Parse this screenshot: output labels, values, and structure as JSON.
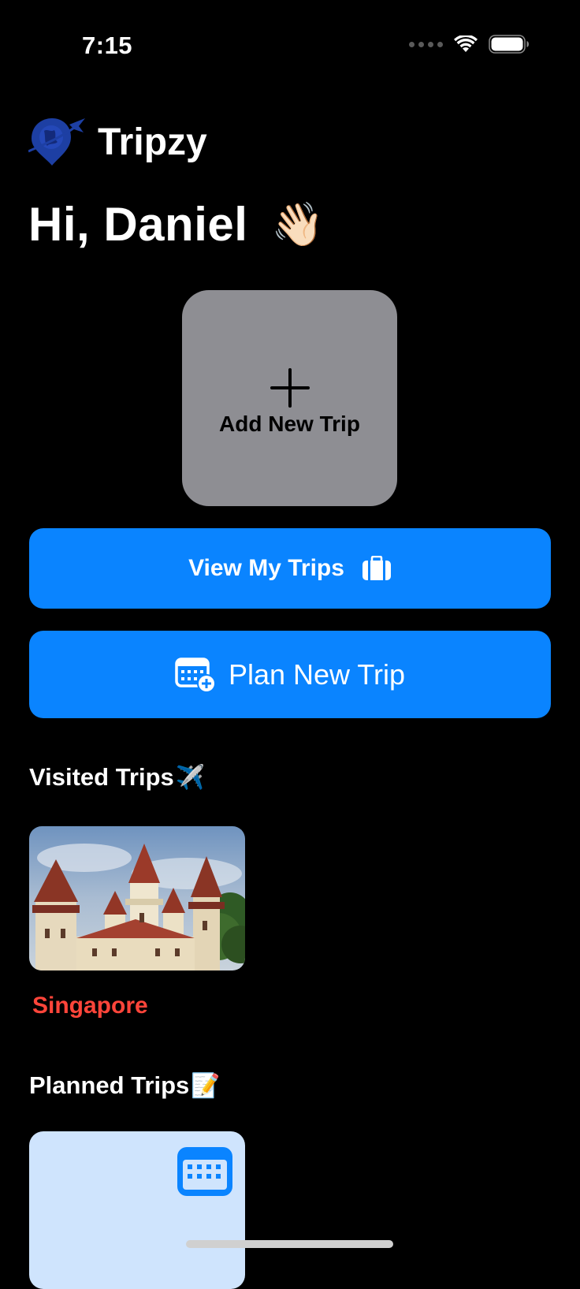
{
  "status_bar": {
    "time": "7:15"
  },
  "app": {
    "name": "Tripzy",
    "logo_icon": "globe-pin-plane-icon"
  },
  "greeting": {
    "text": "Hi, Daniel",
    "emoji": "👋🏻"
  },
  "add_trip": {
    "label": "Add New Trip",
    "icon": "plus-icon"
  },
  "buttons": {
    "view_trips": {
      "label": "View My Trips",
      "icon": "suitcase-icon"
    },
    "plan_trip": {
      "label": "Plan New Trip",
      "icon": "calendar-add-icon"
    }
  },
  "visited": {
    "title": "Visited Trips",
    "emoji": "✈️",
    "trips": [
      {
        "name": "Singapore"
      }
    ]
  },
  "planned": {
    "title": "Planned Trips",
    "emoji": "📝",
    "card_icon": "calendar-icon"
  },
  "colors": {
    "background": "#000000",
    "accent_blue": "#0a84ff",
    "card_gray": "#8e8e93",
    "trip_name_red": "#ff453a",
    "planned_card_bg": "#cfe4fd",
    "logo_blue": "#1d3fa3"
  }
}
